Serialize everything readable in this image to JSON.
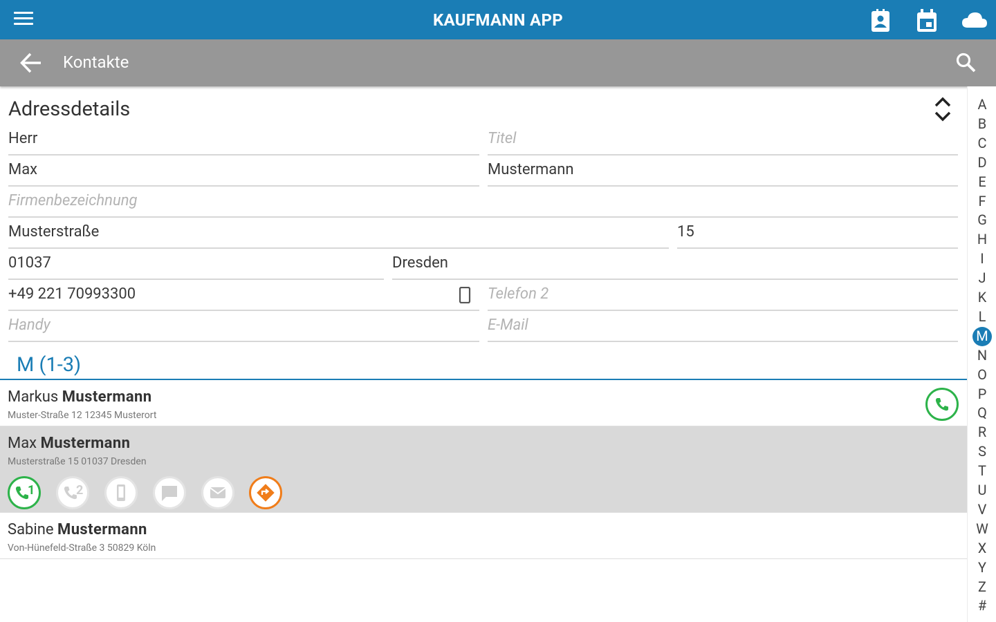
{
  "app": {
    "title": "KAUFMANN APP"
  },
  "toolbar": {
    "title": "Kontakte"
  },
  "details": {
    "heading": "Adressdetails",
    "salutation": "Herr",
    "title_placeholder": "Titel",
    "first_name": "Max",
    "last_name": "Mustermann",
    "company_placeholder": "Firmenbezeichnung",
    "street": "Musterstraße",
    "house_number": "15",
    "zip": "01037",
    "city": "Dresden",
    "phone1": "+49 221 70993300",
    "phone2_placeholder": "Telefon 2",
    "mobile_placeholder": "Handy",
    "email_placeholder": "E-Mail"
  },
  "group": {
    "header": "M (1-3)"
  },
  "contacts": [
    {
      "first": "Markus",
      "last": "Mustermann",
      "address": "Muster-Straße 12 12345 Musterort"
    },
    {
      "first": "Max",
      "last": "Mustermann",
      "address": "Musterstraße 15 01037 Dresden"
    },
    {
      "first": "Sabine",
      "last": "Mustermann",
      "address": "Von-Hünefeld-Straße 3 50829 Köln"
    }
  ],
  "actions": {
    "call1": "1",
    "call2": "2"
  },
  "index": [
    "A",
    "B",
    "C",
    "D",
    "E",
    "F",
    "G",
    "H",
    "I",
    "J",
    "K",
    "L",
    "M",
    "N",
    "O",
    "P",
    "Q",
    "R",
    "S",
    "T",
    "U",
    "V",
    "W",
    "X",
    "Y",
    "Z",
    "#"
  ],
  "colors": {
    "primary": "#1a7db5",
    "toolbar": "#979797",
    "call_green": "#2db34a",
    "nav_orange": "#f07d1a",
    "disabled": "#d0d0d0"
  }
}
